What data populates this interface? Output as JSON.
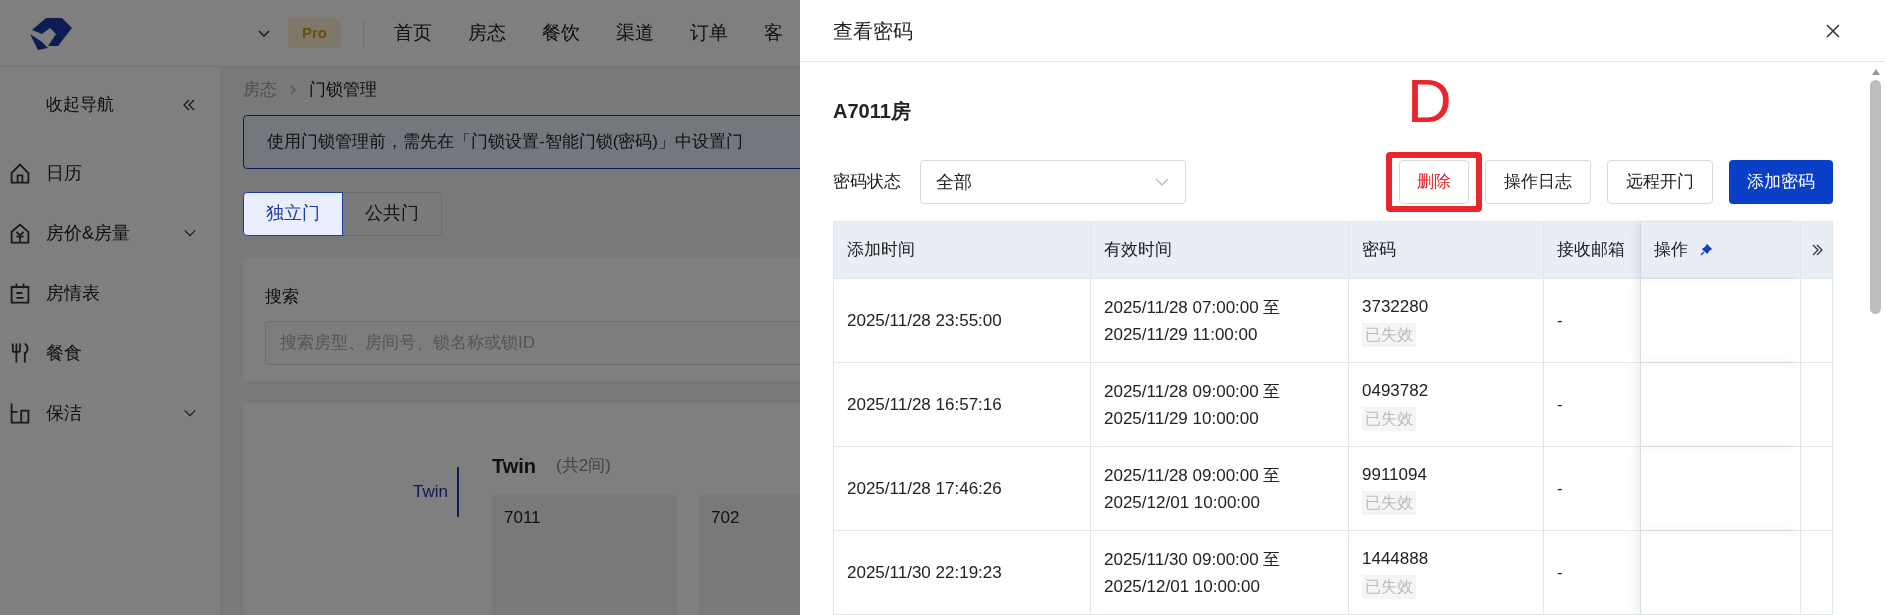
{
  "top_nav": {
    "badge": "Pro",
    "items": [
      "首页",
      "房态",
      "餐饮",
      "渠道",
      "订单",
      "客"
    ]
  },
  "sidebar": {
    "collapse": "收起导航",
    "items": [
      {
        "label": "日历",
        "kind": "plain"
      },
      {
        "label": "房价&房量",
        "kind": "group"
      },
      {
        "label": "房情表",
        "kind": "plain"
      },
      {
        "label": "餐食",
        "kind": "plain"
      },
      {
        "label": "保洁",
        "kind": "group"
      }
    ]
  },
  "breadcrumb": [
    "房态",
    "门锁管理"
  ],
  "notice": "使用门锁管理前，需先在「门锁设置-智能门锁(密码)」中设置门",
  "door_tabs": [
    {
      "label": "独立门",
      "selected": true
    },
    {
      "label": "公共门",
      "selected": false
    }
  ],
  "search": {
    "label": "搜索",
    "placeholder": "搜索房型、房间号、锁名称或锁ID"
  },
  "room_type": {
    "tab": "Twin",
    "title": "Twin",
    "count": "(共2间)",
    "rooms": [
      "7011",
      "702"
    ]
  },
  "drawer": {
    "title": "查看密码",
    "room": "A7011房",
    "filter_label": "密码状态",
    "filter_value": "全部",
    "buttons": [
      {
        "label": "删除",
        "kind": "danger"
      },
      {
        "label": "操作日志",
        "kind": "default"
      },
      {
        "label": "远程开门",
        "kind": "default"
      },
      {
        "label": "添加密码",
        "kind": "primary"
      }
    ],
    "annotation": "D",
    "table": {
      "columns": [
        "添加时间",
        "有效时间",
        "密码",
        "接收邮箱",
        "操作"
      ],
      "rows": [
        {
          "added": "2025/11/28 23:55:00",
          "valid_from": "2025/11/28 07:00:00 至",
          "valid_to": "2025/11/29 11:00:00",
          "password": "3732280",
          "status": "已失效",
          "email": "-"
        },
        {
          "added": "2025/11/28 16:57:16",
          "valid_from": "2025/11/28 09:00:00 至",
          "valid_to": "2025/11/29 10:00:00",
          "password": "0493782",
          "status": "已失效",
          "email": "-"
        },
        {
          "added": "2025/11/28 17:46:26",
          "valid_from": "2025/11/28 09:00:00 至",
          "valid_to": "2025/12/01 10:00:00",
          "password": "9911094",
          "status": "已失效",
          "email": "-"
        },
        {
          "added": "2025/11/30 22:19:23",
          "valid_from": "2025/11/30 09:00:00 至",
          "valid_to": "2025/12/01 10:00:00",
          "password": "1444888",
          "status": "已失效",
          "email": "-"
        }
      ]
    }
  }
}
